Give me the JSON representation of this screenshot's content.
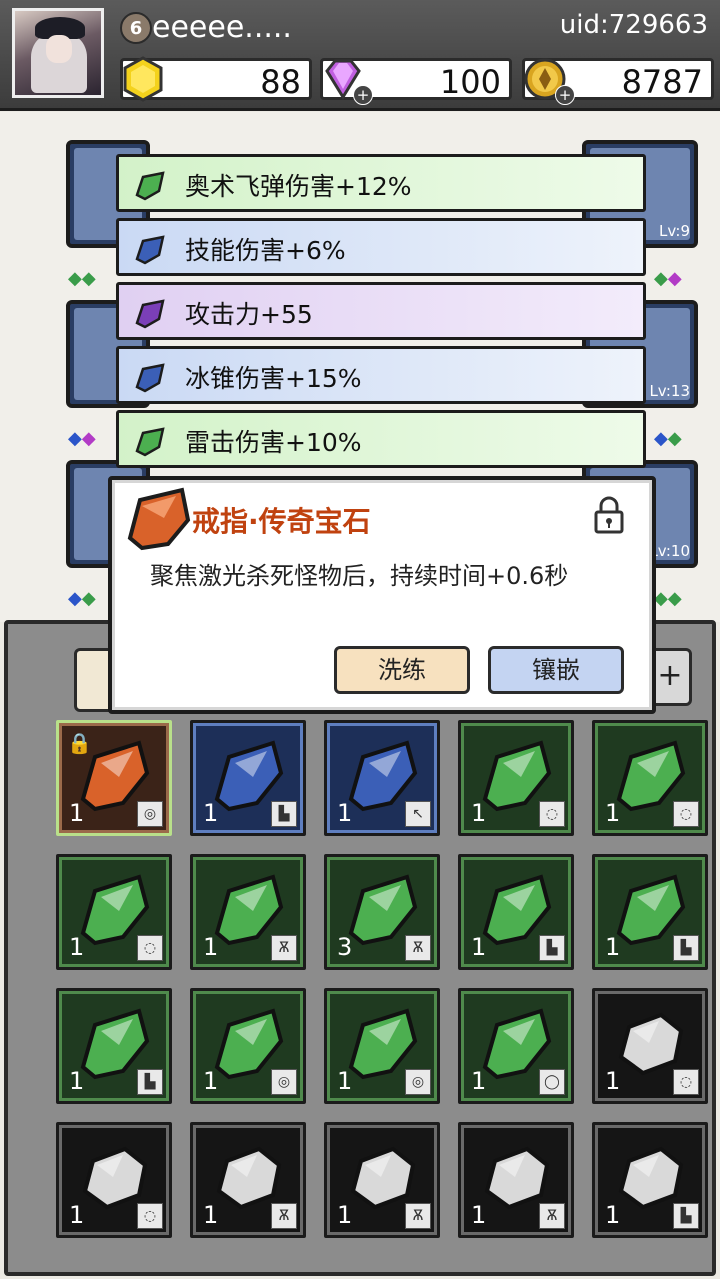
{
  "header": {
    "level": "6",
    "player_name": "eeeee.....",
    "uid": "uid:729663",
    "resources": [
      {
        "icon": "gold-hexagon-icon",
        "value": "88",
        "has_plus": false
      },
      {
        "icon": "purple-diamond-icon",
        "value": "100",
        "has_plus": true
      },
      {
        "icon": "gold-coin-icon",
        "value": "8787",
        "has_plus": true
      }
    ]
  },
  "equipment": {
    "levels": [
      "Lv:9",
      "Lv:13",
      "Lv:10"
    ]
  },
  "stats": [
    {
      "text": "奥术飞弹伤害+12%",
      "color": "green"
    },
    {
      "text": "技能伤害+6%",
      "color": "blue"
    },
    {
      "text": "攻击力+55",
      "color": "purple"
    },
    {
      "text": "冰锥伤害+15%",
      "color": "blue"
    },
    {
      "text": "雷击伤害+10%",
      "color": "green"
    }
  ],
  "detail": {
    "title": "戒指·传奇宝石",
    "description": "聚焦激光杀死怪物后，持续时间+0.6秒",
    "refine_label": "洗练",
    "inlay_label": "镶嵌",
    "locked": true
  },
  "inventory": {
    "plus_label": "+",
    "items": [
      {
        "rarity": "orange",
        "count": "1",
        "slot": "ring",
        "locked": true,
        "selected": true
      },
      {
        "rarity": "blue",
        "count": "1",
        "slot": "boots"
      },
      {
        "rarity": "blue",
        "count": "1",
        "slot": "staff"
      },
      {
        "rarity": "green",
        "count": "1",
        "slot": "amulet"
      },
      {
        "rarity": "green",
        "count": "1",
        "slot": "amulet"
      },
      {
        "rarity": "green",
        "count": "1",
        "slot": "amulet"
      },
      {
        "rarity": "green",
        "count": "1",
        "slot": "robe"
      },
      {
        "rarity": "green",
        "count": "3",
        "slot": "robe"
      },
      {
        "rarity": "green",
        "count": "1",
        "slot": "boots"
      },
      {
        "rarity": "green",
        "count": "1",
        "slot": "boots"
      },
      {
        "rarity": "green",
        "count": "1",
        "slot": "boots"
      },
      {
        "rarity": "green",
        "count": "1",
        "slot": "ring"
      },
      {
        "rarity": "green",
        "count": "1",
        "slot": "ring"
      },
      {
        "rarity": "green",
        "count": "1",
        "slot": "necklace"
      },
      {
        "rarity": "white",
        "count": "1",
        "slot": "amulet"
      },
      {
        "rarity": "white",
        "count": "1",
        "slot": "amulet"
      },
      {
        "rarity": "white",
        "count": "1",
        "slot": "robe"
      },
      {
        "rarity": "white",
        "count": "1",
        "slot": "robe"
      },
      {
        "rarity": "white",
        "count": "1",
        "slot": "robe"
      },
      {
        "rarity": "white",
        "count": "1",
        "slot": "boots"
      }
    ]
  },
  "colors": {
    "green_gem": "#4caf50",
    "blue_gem": "#3b5fb7",
    "purple_gem": "#7b3fb8",
    "orange_gem": "#d9622a",
    "white_gem": "#d9d9d9",
    "title_color": "#c0420f"
  }
}
